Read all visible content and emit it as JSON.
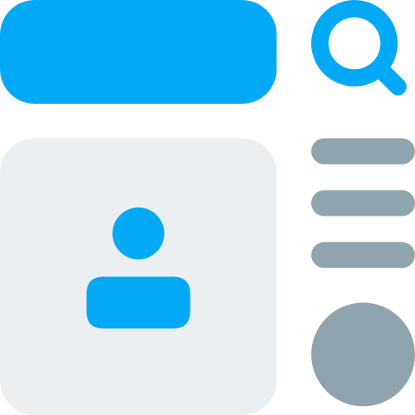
{
  "colors": {
    "accent": "#03A9F4",
    "panel": "#ECEFF1",
    "muted": "#90A4AE"
  },
  "icons": {
    "search": "search-icon",
    "user": "user-icon"
  }
}
